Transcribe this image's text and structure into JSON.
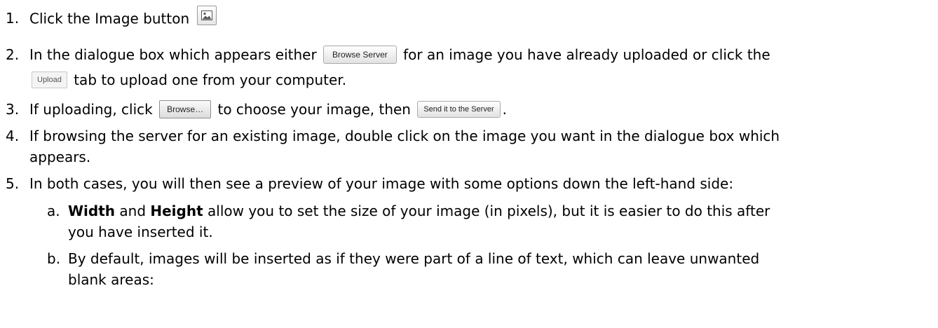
{
  "steps": [
    {
      "num": "1.",
      "pre": "Click the Image button",
      "icon": "image-icon"
    },
    {
      "num": "2.",
      "pre": "In the dialogue box which appears either",
      "btn": "Browse Server",
      "post": "for an image you have already uploaded or click the",
      "line2_btn": "Upload",
      "line2_post": "tab to upload one from your computer."
    },
    {
      "num": "3.",
      "pre": "If uploading, click",
      "btn": "Browse…",
      "mid": "to choose your image, then",
      "btn2": "Send it to the Server",
      "post": "."
    },
    {
      "num": "4.",
      "line1": "If browsing the server for an existing image, double click on the image you want in the dialogue box which",
      "line2": "appears."
    },
    {
      "num": "5.",
      "line1": "In both cases, you will then see a preview of your image with some options down the left-hand side:"
    }
  ],
  "substeps": [
    {
      "num": "a.",
      "bold1": "Width",
      "and": " and ",
      "bold2": "Height",
      "rest": " allow you to set the size of your image (in pixels), but it is easier to do this after",
      "line2": "you have inserted it."
    },
    {
      "num": "b.",
      "line1": "By default, images will be inserted as if they were part of a line of text, which can leave unwanted",
      "line2": "blank areas:"
    }
  ]
}
